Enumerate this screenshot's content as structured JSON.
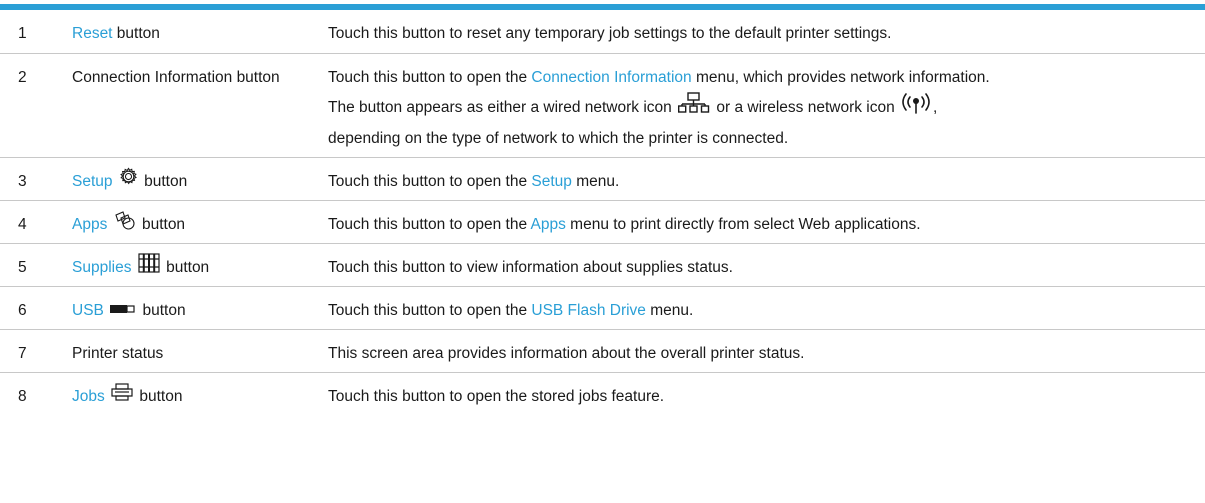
{
  "rows": [
    {
      "num": "1",
      "link": "Reset",
      "name_suffix": " button",
      "desc_pre": "Touch this button to reset any temporary job settings to the default printer settings.",
      "desc_link": "",
      "desc_post": ""
    },
    {
      "num": "2",
      "name": "Connection Information button",
      "desc_pre": "Touch this button to open the ",
      "desc_link": "Connection Information",
      "desc_post": " menu, which provides network information.",
      "line2_pre": "The button appears as either a wired network icon ",
      "line2_mid": " or a wireless network icon ",
      "line2_post": ",",
      "line3": "depending on the type of network to which the printer is connected.",
      "icons": [
        "wired-network-icon",
        "wireless-network-icon"
      ]
    },
    {
      "num": "3",
      "link": "Setup",
      "name_suffix": " button",
      "icon": "gear-icon",
      "desc_pre": "Touch this button to open the ",
      "desc_link": "Setup",
      "desc_post": " menu."
    },
    {
      "num": "4",
      "link": "Apps",
      "name_suffix": " button",
      "icon": "apps-icon",
      "desc_pre": "Touch this button to open the ",
      "desc_link": "Apps",
      "desc_post": " menu to print directly from select Web applications."
    },
    {
      "num": "5",
      "link": "Supplies",
      "name_suffix": " button",
      "icon": "supplies-icon",
      "desc_pre": "Touch this button to view information about supplies status.",
      "desc_link": "",
      "desc_post": ""
    },
    {
      "num": "6",
      "link": "USB",
      "name_suffix": " button",
      "icon": "usb-drive-icon",
      "desc_pre": "Touch this button to open the ",
      "desc_link": "USB Flash Drive",
      "desc_post": " menu."
    },
    {
      "num": "7",
      "name": "Printer status",
      "desc_pre": "This screen area provides information about the overall printer status.",
      "desc_link": "",
      "desc_post": ""
    },
    {
      "num": "8",
      "link": "Jobs",
      "name_suffix": " button",
      "icon": "jobs-icon",
      "desc_pre": "Touch this button to open the stored jobs feature.",
      "desc_link": "",
      "desc_post": ""
    }
  ],
  "colors": {
    "accent": "#2a9fd6",
    "rule": "#c8c8c8"
  }
}
